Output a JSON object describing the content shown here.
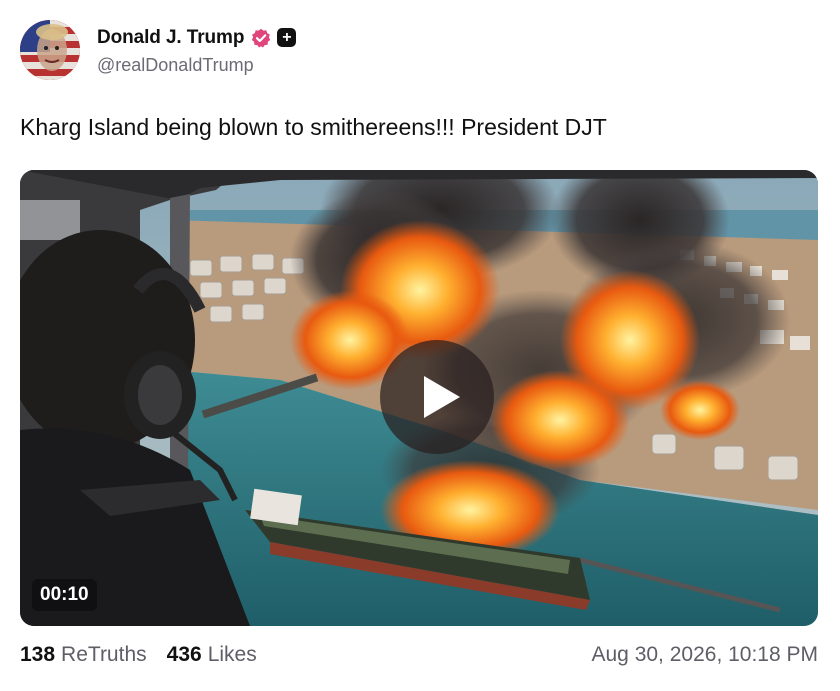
{
  "post": {
    "author": {
      "display_name": "Donald J. Trump",
      "handle": "@realDonaldTrump",
      "verified_icon": "verified-badge-icon",
      "plus_icon": "plus-badge-icon",
      "plus_symbol": "+"
    },
    "text": "Kharg Island being blown to smithereens!!! President DJT",
    "media": {
      "type": "video",
      "duration": "00:10",
      "play_icon": "play-icon"
    },
    "stats": {
      "retruths_count": "138",
      "retruths_label": "ReTruths",
      "likes_count": "436",
      "likes_label": "Likes"
    },
    "timestamp": "Aug 30, 2026, 10:18 PM"
  },
  "colors": {
    "verified_badge": "#e0457b",
    "text_primary": "#111111",
    "text_secondary": "#5e5e66"
  }
}
